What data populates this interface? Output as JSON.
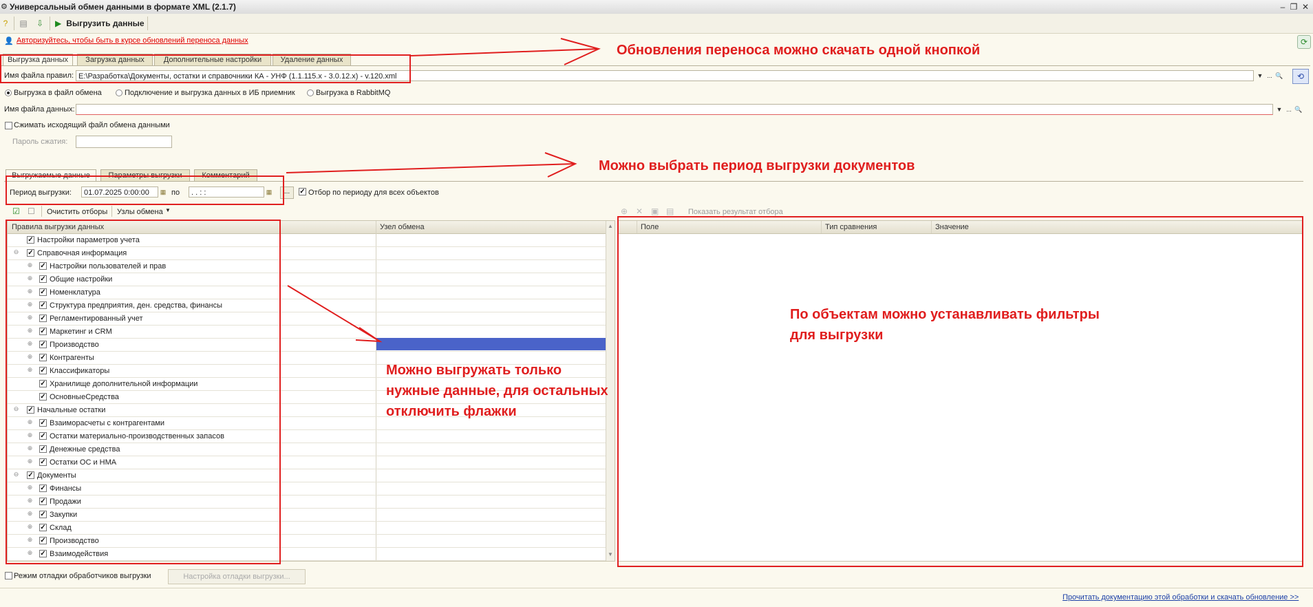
{
  "window": {
    "title": "Универсальный обмен данными в формате XML (2.1.7)"
  },
  "toolbar": {
    "export_label": "Выгрузить данные"
  },
  "auth_link": "Авторизуйтесь, чтобы быть в курсе обновлений переноса данных",
  "tabs": [
    "Выгрузка данных",
    "Загрузка данных",
    "Дополнительные настройки",
    "Удаление данных"
  ],
  "rules_file": {
    "label": "Имя файла правил:",
    "value": "E:\\Разработка\\Документы, остатки и справочники КА - УНФ (1.1.115.x - 3.0.12.x) - v.120.xml"
  },
  "export_mode": {
    "options": [
      "Выгрузка в файл обмена",
      "Подключение и выгрузка данных в ИБ приемник",
      "Выгрузка в RabbitMQ"
    ],
    "selected": "Выгрузка в файл обмена"
  },
  "data_file": {
    "label": "Имя файла данных:",
    "value": ""
  },
  "compress": {
    "label": "Сжимать исходящий файл обмена данными",
    "checked": false
  },
  "password": {
    "label": "Пароль сжатия:",
    "value": ""
  },
  "inner_tabs": [
    "Выгружаемые данные",
    "Параметры выгрузки",
    "Комментарий"
  ],
  "period": {
    "label": "Период выгрузки:",
    "from": "01.07.2025  0:00:00",
    "to_label": "по",
    "to": " .  .       :  :",
    "filter_label": "Отбор по периоду для всех объектов",
    "filter_checked": true
  },
  "grid_toolbar": {
    "clear_filters": "Очистить отборы",
    "exchange_nodes": "Узлы обмена"
  },
  "rules_grid": {
    "col1": "Правила выгрузки данных",
    "col2": "Узел обмена",
    "rows": [
      {
        "label": "Настройки параметров учета",
        "level": 1,
        "toggle": ""
      },
      {
        "label": "Справочная информация",
        "level": 0,
        "toggle": "−"
      },
      {
        "label": "Настройки пользователей и прав",
        "level": 2,
        "toggle": "+"
      },
      {
        "label": "Общие настройки",
        "level": 2,
        "toggle": "+"
      },
      {
        "label": "Номенклатура",
        "level": 2,
        "toggle": "+"
      },
      {
        "label": "Структура предприятия, ден. средства, финансы",
        "level": 2,
        "toggle": "+"
      },
      {
        "label": "Регламентированный учет",
        "level": 2,
        "toggle": "+"
      },
      {
        "label": "Маркетинг и CRM",
        "level": 2,
        "toggle": "+"
      },
      {
        "label": "Производство",
        "level": 2,
        "toggle": "+"
      },
      {
        "label": "Контрагенты",
        "level": 2,
        "toggle": "+"
      },
      {
        "label": "Классификаторы",
        "level": 2,
        "toggle": "+"
      },
      {
        "label": "Хранилище дополнительной информации",
        "level": 2,
        "toggle": ""
      },
      {
        "label": "ОсновныеСредства",
        "level": 2,
        "toggle": ""
      },
      {
        "label": "Начальные остатки",
        "level": 0,
        "toggle": "−"
      },
      {
        "label": "Взаиморасчеты с контрагентами",
        "level": 2,
        "toggle": "+"
      },
      {
        "label": "Остатки материально-производственных запасов",
        "level": 2,
        "toggle": "+"
      },
      {
        "label": "Денежные средства",
        "level": 2,
        "toggle": "+"
      },
      {
        "label": "Остатки ОС и НМА",
        "level": 2,
        "toggle": "+"
      },
      {
        "label": "Документы",
        "level": 0,
        "toggle": "−"
      },
      {
        "label": "Финансы",
        "level": 2,
        "toggle": "+"
      },
      {
        "label": "Продажи",
        "level": 2,
        "toggle": "+"
      },
      {
        "label": "Закупки",
        "level": 2,
        "toggle": "+"
      },
      {
        "label": "Склад",
        "level": 2,
        "toggle": "+"
      },
      {
        "label": "Производство",
        "level": 2,
        "toggle": "+"
      },
      {
        "label": "Взаимодействия",
        "level": 2,
        "toggle": "+"
      }
    ],
    "selected_row_index": 8
  },
  "filter_grid": {
    "show_result": "Показать результат отбора",
    "columns": [
      "Поле",
      "Тип сравнения",
      "Значение"
    ]
  },
  "debug": {
    "label": "Режим отладки обработчиков выгрузки",
    "button": "Настройка отладки выгрузки..."
  },
  "footer_link": "Прочитать документацию этой обработки и скачать обновление >>",
  "annotations": {
    "a1": "Обновления переноса можно скачать одной кнопкой",
    "a2": "Можно выбрать период выгрузки документов",
    "a3_lines": [
      "Можно выгружать только",
      "нужные данные, для остальных",
      "отключить флажки"
    ],
    "a4_lines": [
      "По объектам можно устанавливать фильтры",
      "для выгрузки"
    ]
  },
  "colors": {
    "annotation": "#e01e1e",
    "selection": "#4a63c9",
    "link_red": "#e00000",
    "link_blue": "#1b3fa6"
  }
}
